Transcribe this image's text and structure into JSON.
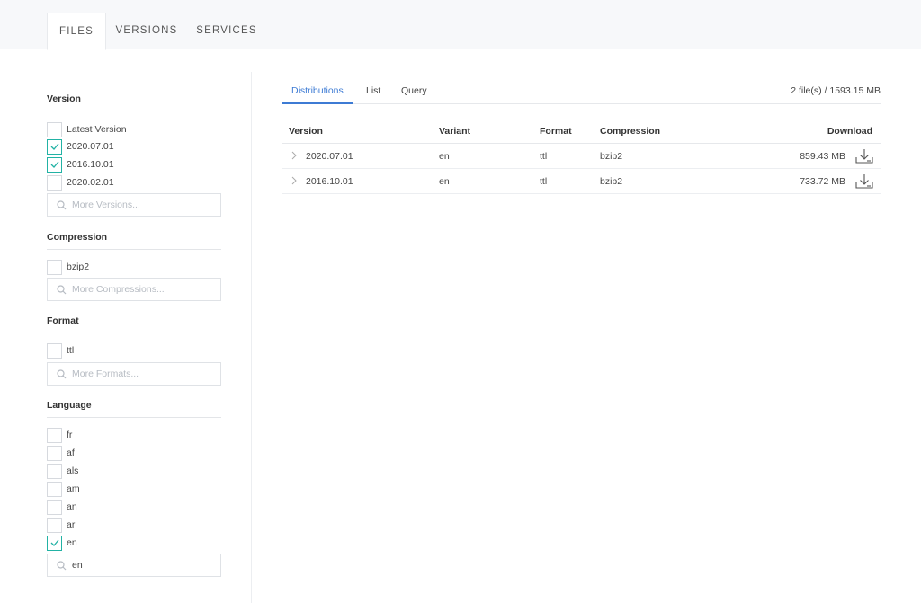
{
  "top_tabs": [
    "FILES",
    "VERSIONS",
    "SERVICES"
  ],
  "facets": {
    "version": {
      "title": "Version",
      "options": [
        {
          "label": "Latest Version",
          "checked": false
        },
        {
          "label": "2020.07.01",
          "checked": true
        },
        {
          "label": "2016.10.01",
          "checked": true
        },
        {
          "label": "2020.02.01",
          "checked": false
        }
      ],
      "search_placeholder": "More Versions..."
    },
    "compression": {
      "title": "Compression",
      "options": [
        {
          "label": "bzip2",
          "checked": false
        }
      ],
      "search_placeholder": "More Compressions..."
    },
    "format": {
      "title": "Format",
      "options": [
        {
          "label": "ttl",
          "checked": false
        }
      ],
      "search_placeholder": "More Formats..."
    },
    "language": {
      "title": "Language",
      "options": [
        {
          "label": "fr",
          "checked": false
        },
        {
          "label": "af",
          "checked": false
        },
        {
          "label": "als",
          "checked": false
        },
        {
          "label": "am",
          "checked": false
        },
        {
          "label": "an",
          "checked": false
        },
        {
          "label": "ar",
          "checked": false
        },
        {
          "label": "en",
          "checked": true
        }
      ],
      "search_value": "en"
    }
  },
  "sub_tabs": [
    "Distributions",
    "List",
    "Query"
  ],
  "summary": "2 file(s) / 1593.15 MB",
  "table": {
    "headers": {
      "version": "Version",
      "variant": "Variant",
      "format": "Format",
      "compression": "Compression",
      "download": "Download"
    },
    "rows": [
      {
        "version": "2020.07.01",
        "variant": "en",
        "format": "ttl",
        "compression": "bzip2",
        "size": "859.43 MB"
      },
      {
        "version": "2016.10.01",
        "variant": "en",
        "format": "ttl",
        "compression": "bzip2",
        "size": "733.72 MB"
      }
    ]
  },
  "colors": {
    "accent_teal": "#22b2a4",
    "accent_blue": "#3d7bd4"
  }
}
